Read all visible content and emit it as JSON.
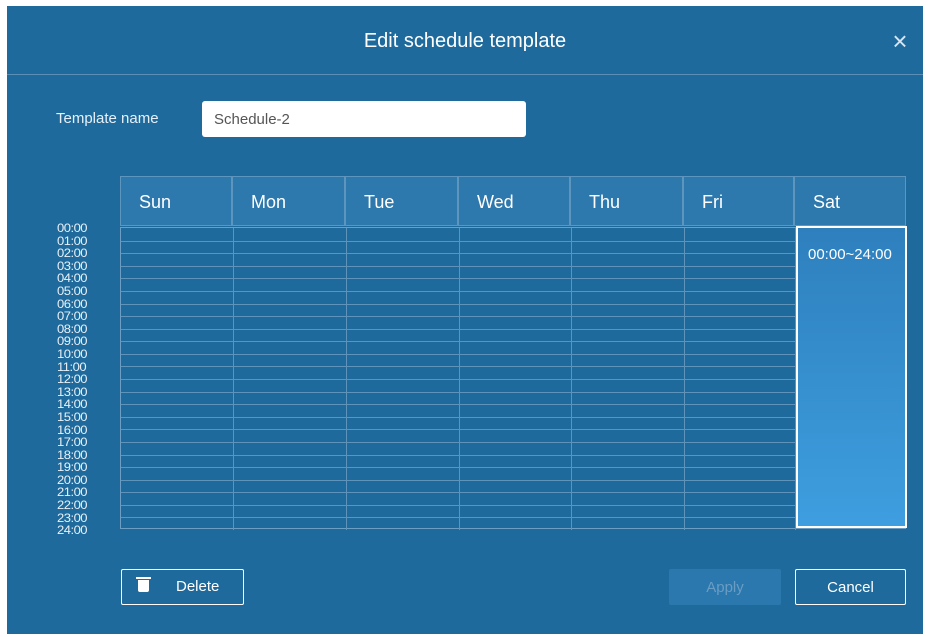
{
  "dialog": {
    "title": "Edit schedule template",
    "close_icon": "×"
  },
  "template": {
    "label": "Template name",
    "value": "Schedule-2"
  },
  "days": [
    "Sun",
    "Mon",
    "Tue",
    "Wed",
    "Thu",
    "Fri",
    "Sat"
  ],
  "hours": [
    "00:00",
    "01:00",
    "02:00",
    "03:00",
    "04:00",
    "05:00",
    "06:00",
    "07:00",
    "08:00",
    "09:00",
    "10:00",
    "11:00",
    "12:00",
    "13:00",
    "14:00",
    "15:00",
    "16:00",
    "17:00",
    "18:00",
    "19:00",
    "20:00",
    "21:00",
    "22:00",
    "23:00",
    "24:00"
  ],
  "schedule": {
    "sat_range": "00:00~24:00"
  },
  "buttons": {
    "delete": "Delete",
    "apply": "Apply",
    "cancel": "Cancel"
  },
  "colors": {
    "dialog_bg": "#1f6a9c",
    "header_cell": "#2d78ac",
    "selected_block": "#3e9edf",
    "apply_disabled": "#2a78ad"
  }
}
